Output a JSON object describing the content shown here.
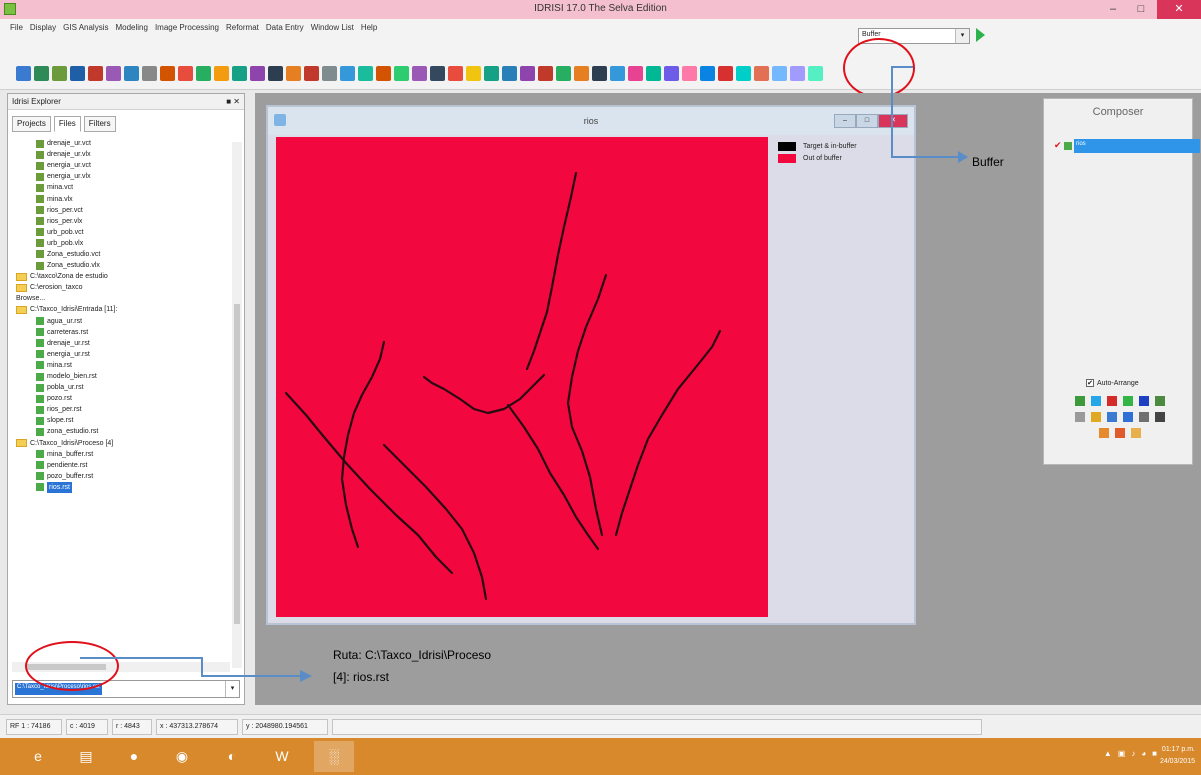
{
  "titlebar": {
    "title": "IDRISI 17.0    The Selva Edition",
    "minimize": "–",
    "maximize": "□",
    "close": "✕"
  },
  "menu": [
    "File",
    "Display",
    "GIS Analysis",
    "Modeling",
    "Image Processing",
    "Reformat",
    "Data Entry",
    "Window List",
    "Help"
  ],
  "toolbar": {
    "module_combo": "Buffer",
    "combo_arrow": "▾"
  },
  "explorer": {
    "title": "Idrisi Explorer",
    "pin": "■ ✕",
    "tabs": [
      "Projects",
      "Files",
      "Filters"
    ],
    "tree": [
      {
        "label": "drenaje_ur.vct",
        "type": "vec",
        "level": 1
      },
      {
        "label": "drenaje_ur.vlx",
        "type": "vec",
        "level": 1
      },
      {
        "label": "energia_ur.vct",
        "type": "vec",
        "level": 1
      },
      {
        "label": "energia_ur.vlx",
        "type": "vec",
        "level": 1
      },
      {
        "label": "mina.vct",
        "type": "vec",
        "level": 1
      },
      {
        "label": "mina.vlx",
        "type": "vec",
        "level": 1
      },
      {
        "label": "rios_per.vct",
        "type": "vec",
        "level": 1
      },
      {
        "label": "rios_per.vlx",
        "type": "vec",
        "level": 1
      },
      {
        "label": "urb_pob.vct",
        "type": "vec",
        "level": 1
      },
      {
        "label": "urb_pob.vlx",
        "type": "vec",
        "level": 1
      },
      {
        "label": "Zona_estudio.vct",
        "type": "vec",
        "level": 1
      },
      {
        "label": "Zona_estudio.vlx",
        "type": "vec",
        "level": 1
      },
      {
        "label": "C:\\taxco\\Zona de estudio",
        "type": "folder",
        "level": 0
      },
      {
        "label": "C:\\erosion_taxco",
        "type": "folder",
        "level": 0
      },
      {
        "label": "Browse...",
        "type": "none",
        "level": 0
      },
      {
        "label": "C:\\Taxco_Idrisi\\Entrada [11]:",
        "type": "folder",
        "level": 0
      },
      {
        "label": "agua_ur.rst",
        "type": "ras",
        "level": 1
      },
      {
        "label": "carreteras.rst",
        "type": "ras",
        "level": 1
      },
      {
        "label": "drenaje_ur.rst",
        "type": "ras",
        "level": 1
      },
      {
        "label": "energia_ur.rst",
        "type": "ras",
        "level": 1
      },
      {
        "label": "mina.rst",
        "type": "ras",
        "level": 1
      },
      {
        "label": "modelo_bien.rst",
        "type": "ras",
        "level": 1
      },
      {
        "label": "pobla_ur.rst",
        "type": "ras",
        "level": 1
      },
      {
        "label": "pozo.rst",
        "type": "ras",
        "level": 1
      },
      {
        "label": "rios_per.rst",
        "type": "ras",
        "level": 1
      },
      {
        "label": "slope.rst",
        "type": "ras",
        "level": 1
      },
      {
        "label": "zona_estudio.rst",
        "type": "ras",
        "level": 1
      },
      {
        "label": "C:\\Taxco_Idrisi\\Proceso [4]",
        "type": "folder",
        "level": 0
      },
      {
        "label": "mina_buffer.rst",
        "type": "ras",
        "level": 1
      },
      {
        "label": "pendiente.rst",
        "type": "ras",
        "level": 1
      },
      {
        "label": "pozo_buffer.rst",
        "type": "ras",
        "level": 1
      },
      {
        "label": "rios.rst",
        "type": "ras",
        "level": 1,
        "selected": true
      }
    ],
    "filter": "C:\\Taxco_Idrisi\\Proceso\\rios.rst",
    "filter_arrow": "▾"
  },
  "map_window": {
    "title": "rios",
    "buttons": [
      "–",
      "□",
      "✕"
    ],
    "legend": [
      {
        "label": "Target & in-buffer",
        "color": "#000000"
      },
      {
        "label": "Out of buffer",
        "color": "#f2083e"
      }
    ]
  },
  "composer": {
    "title": "Composer",
    "layer_check": "✔",
    "layer": "rios",
    "auto_arrange_check": "✔",
    "auto_arrange": "Auto-Arrange"
  },
  "annotations": {
    "buffer": "Buffer",
    "path_line1": "Ruta: C:\\Taxco_Idrisi\\Proceso",
    "path_line2": "[4]: rios.rst"
  },
  "statusbar": {
    "rf": "RF 1 : 74186",
    "c": "c : 4019",
    "r": "r : 4843",
    "x": "x : 437313.278674",
    "y": "y : 2048980.194561"
  },
  "taskbar": {
    "apps": [
      "e",
      "▤",
      "●",
      "◉",
      "◐",
      "W",
      "░"
    ],
    "tray": [
      "▲",
      "▣",
      "♪",
      "◕",
      "■"
    ],
    "time": "01:17 p.m.",
    "date": "24/03/2015"
  },
  "colors": {
    "accent": "#f2083e",
    "selection": "#2a74d5",
    "taskbar": "#d7892c",
    "annotation_circle": "#e0101a"
  }
}
